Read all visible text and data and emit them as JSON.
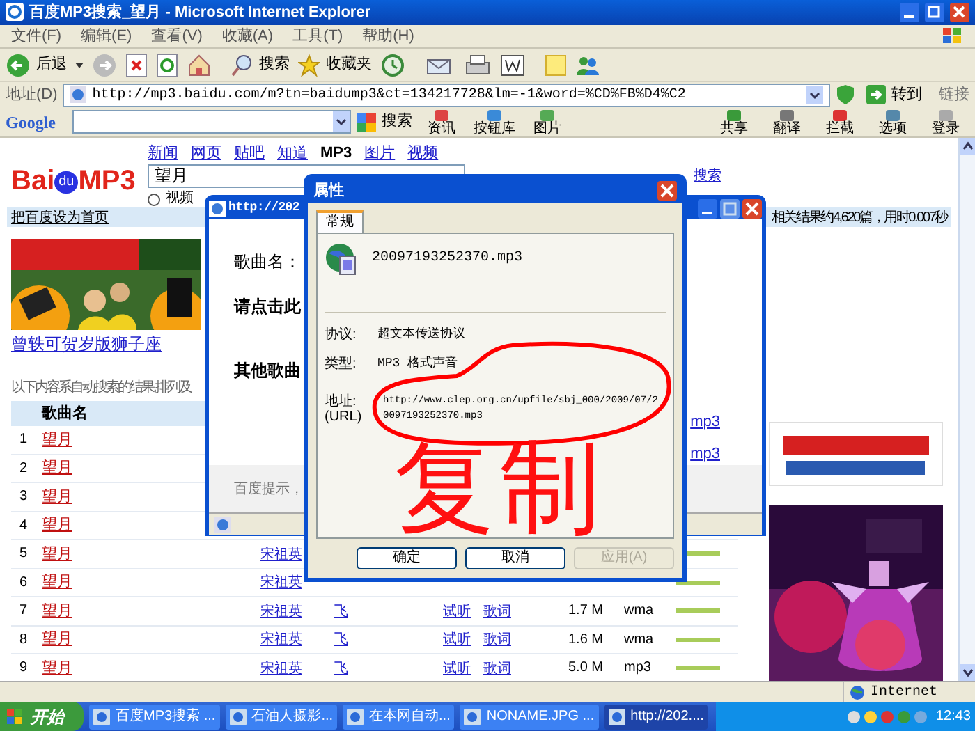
{
  "window": {
    "title": "百度MP3搜索_望月 - Microsoft Internet Explorer"
  },
  "menu": [
    "文件(F)",
    "编辑(E)",
    "查看(V)",
    "收藏(A)",
    "工具(T)",
    "帮助(H)"
  ],
  "toolbar": {
    "back": "后退",
    "search": "搜索",
    "favorites": "收藏夹"
  },
  "address": {
    "label": "地址(D)",
    "url": "http://mp3.baidu.com/m?tn=baidump3&ct=134217728&lm=-1&word=%CD%FB%D4%C2",
    "go": "转到",
    "links": "链接"
  },
  "google_bar": {
    "logo": "Google",
    "search": "搜索",
    "buttons": [
      "资讯",
      "按钮库",
      "图片",
      "共享",
      "翻译",
      "拦截",
      "选项",
      "登录"
    ]
  },
  "page": {
    "logo": [
      "Bai",
      "du",
      "MP3"
    ],
    "nav": [
      {
        "label": "新闻",
        "selected": false
      },
      {
        "label": "网页",
        "selected": false
      },
      {
        "label": "贴吧",
        "selected": false
      },
      {
        "label": "知道",
        "selected": false
      },
      {
        "label": "MP3",
        "selected": true
      },
      {
        "label": "图片",
        "selected": false
      },
      {
        "label": "视频",
        "selected": false
      }
    ],
    "query": "望月",
    "radio": {
      "label": "视频",
      "checked": false
    },
    "advanced": "搜索",
    "homepage_link": "把百度设为首页",
    "summary": "相关结果约4,620篇，用时0.007秒",
    "ad_link": "曾轶可贺岁版狮子座",
    "note": "以下内容系自动搜索的结果,排列及",
    "column": "歌曲名",
    "rows": [
      {
        "n": "1",
        "title": "望月"
      },
      {
        "n": "2",
        "title": "望月"
      },
      {
        "n": "3",
        "title": "望月"
      },
      {
        "n": "4",
        "title": "望月"
      },
      {
        "n": "5",
        "title": "望月",
        "singer": "宋祖英"
      },
      {
        "n": "6",
        "title": "望月",
        "singer": "宋祖英"
      },
      {
        "n": "7",
        "title": "望月",
        "singer": "宋祖英",
        "album": "飞",
        "listen": "试听",
        "lyrics": "歌词",
        "size": "1.7 M",
        "format": "wma"
      },
      {
        "n": "8",
        "title": "望月",
        "singer": "宋祖英",
        "album": "飞",
        "listen": "试听",
        "lyrics": "歌词",
        "size": "1.6 M",
        "format": "wma"
      },
      {
        "n": "9",
        "title": "望月",
        "singer": "宋祖英",
        "album": "飞",
        "listen": "试听",
        "lyrics": "歌词",
        "size": "5.0 M",
        "format": "mp3"
      }
    ]
  },
  "popup": {
    "title": "http://202",
    "lines": [
      "歌曲名：",
      "请点击此",
      "其他歌曲"
    ],
    "links": [
      "mp3",
      "mp3"
    ],
    "hint": "百度提示，"
  },
  "dialog": {
    "title": "属性",
    "tab": "常规",
    "file": "20097193252370.mp3",
    "fields": [
      {
        "label": "协议:",
        "value": "超文本传送协议"
      },
      {
        "label": "类型:",
        "value": "MP3 格式声音"
      },
      {
        "label": "地址:\n(URL)",
        "value": "http://www.clep.org.cn/upfile/sbj_000/2009/07/2\n0097193252370.mp3"
      }
    ],
    "buttons": [
      {
        "label": "确定",
        "disabled": false
      },
      {
        "label": "取消",
        "disabled": false
      },
      {
        "label": "应用(A)",
        "disabled": true
      }
    ],
    "annotation": "复制"
  },
  "status": {
    "zone": "Internet"
  },
  "taskbar": {
    "start": "开始",
    "tasks": [
      {
        "label": "百度MP3搜索 ...",
        "selected": false
      },
      {
        "label": "石油人摄影...",
        "selected": false
      },
      {
        "label": "在本网自动...",
        "selected": false
      },
      {
        "label": "NONAME.JPG ...",
        "selected": false
      },
      {
        "label": "http://202....",
        "selected": true
      }
    ],
    "clock": "12:43"
  }
}
